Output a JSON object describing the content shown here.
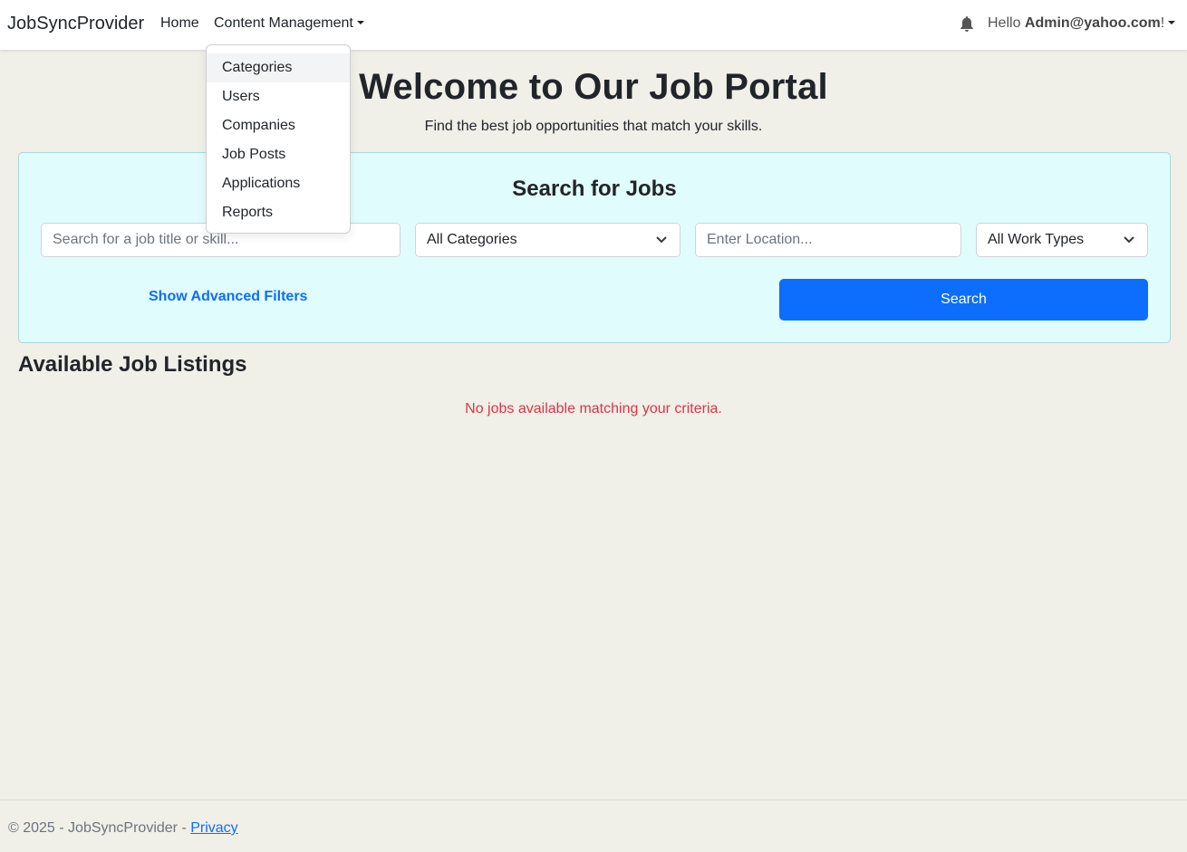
{
  "navbar": {
    "brand": "JobSyncProvider",
    "home_label": "Home",
    "content_management_label": "Content Management",
    "hello_prefix": "Hello ",
    "user_email": "Admin@yahoo.com",
    "hello_suffix": "!"
  },
  "dropdown": {
    "items": [
      {
        "label": "Categories"
      },
      {
        "label": "Users"
      },
      {
        "label": "Companies"
      },
      {
        "label": "Job Posts"
      },
      {
        "label": "Applications"
      },
      {
        "label": "Reports"
      }
    ]
  },
  "hero": {
    "title": "Welcome to Our Job Portal",
    "subtitle": "Find the best job opportunities that match your skills."
  },
  "search": {
    "title": "Search for Jobs",
    "keyword_placeholder": "Search for a job title or skill...",
    "category_selected": "All Categories",
    "location_placeholder": "Enter Location...",
    "worktype_selected": "All Work Types",
    "advanced_filters_label": "Show Advanced Filters",
    "search_button_label": "Search"
  },
  "listings": {
    "title": "Available Job Listings",
    "empty_message": "No jobs available matching your criteria."
  },
  "footer": {
    "copyright": "© 2025 - JobSyncProvider - ",
    "privacy_label": "Privacy"
  },
  "colors": {
    "primary": "#0d6efd",
    "danger": "#dc3545",
    "page_bg": "#f0efe8",
    "search_card_bg": "#e0fcfc"
  },
  "icons": {
    "notification": "bell-icon",
    "select_arrow": "chevron-down-icon",
    "dropdown_caret": "caret-down-icon"
  }
}
